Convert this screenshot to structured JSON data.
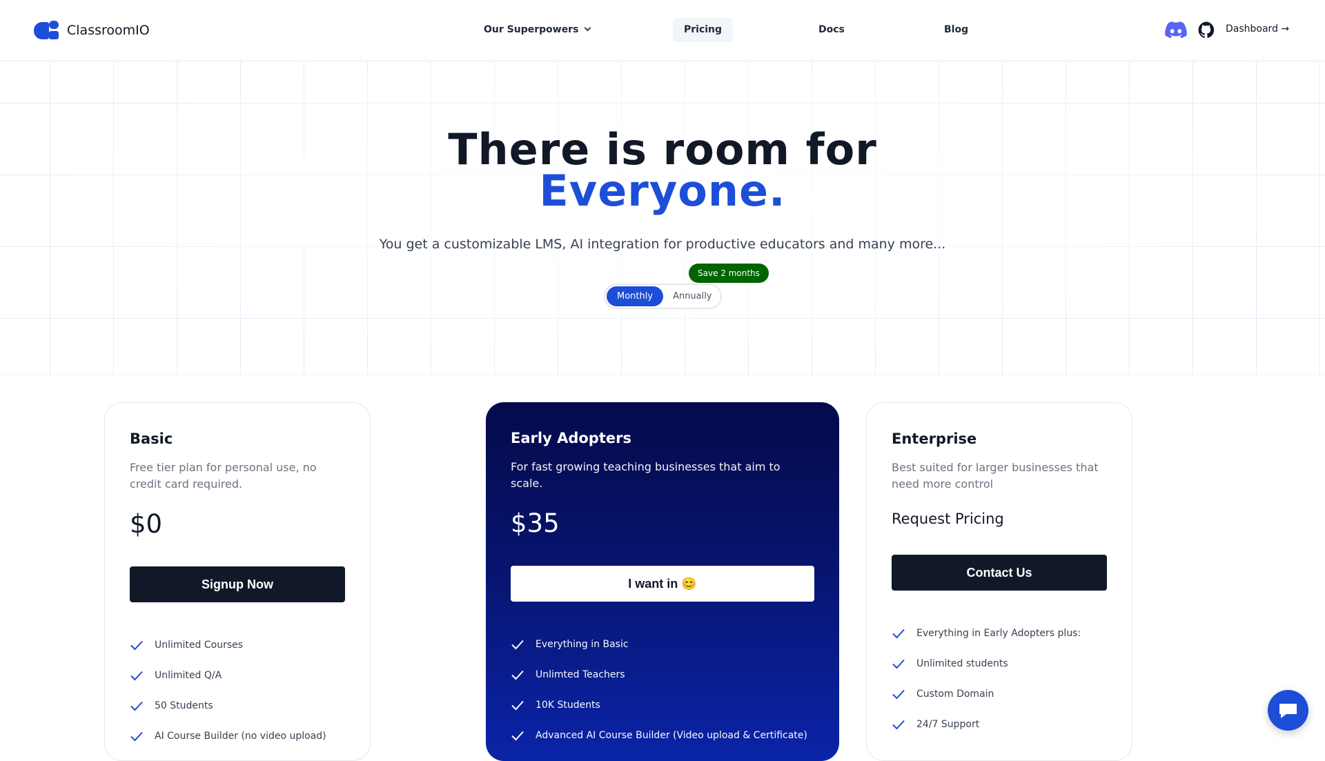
{
  "nav": {
    "brand": "ClassroomIO",
    "links": [
      "Our Superpowers",
      "Pricing",
      "Docs",
      "Blog"
    ],
    "active": "Pricing",
    "dashboard": "Dashboard →",
    "icons": [
      "discord-icon",
      "github-icon"
    ]
  },
  "hero": {
    "title_line1": "There is room for",
    "title_line2": "Everyone.",
    "subtitle": "You get a customizable LMS, AI integration for productive educators and many more...",
    "save_badge": "Save 2 months",
    "toggle_monthly": "Monthly",
    "toggle_annually": "Annually",
    "selected_period": "Monthly"
  },
  "plans": [
    {
      "name": "Basic",
      "description": "Free tier plan for personal use, no credit card required.",
      "price": "$0",
      "cta": "Signup Now",
      "features": [
        "Unlimited Courses",
        "Unlimited Q/A",
        "50 Students",
        "AI Course Builder (no video upload)"
      ]
    },
    {
      "name": "Early Adopters",
      "description": "For fast growing teaching businesses that aim to scale.",
      "price": "$35",
      "cta": "I want in 😊",
      "features": [
        "Everything in Basic",
        "Unlimted Teachers",
        "10K Students",
        "Advanced AI Course Builder (Video upload & Certificate)"
      ]
    },
    {
      "name": "Enterprise",
      "description": "Best suited for larger businesses that need more control",
      "price": "Request Pricing",
      "cta": "Contact Us",
      "features": [
        "Everything in Early Adopters plus:",
        "Unlimited students",
        "Custom Domain",
        "24/7 Support"
      ]
    }
  ],
  "colors": {
    "brand": "#1d4ed8",
    "dark": "#111827",
    "badge": "#006400"
  }
}
